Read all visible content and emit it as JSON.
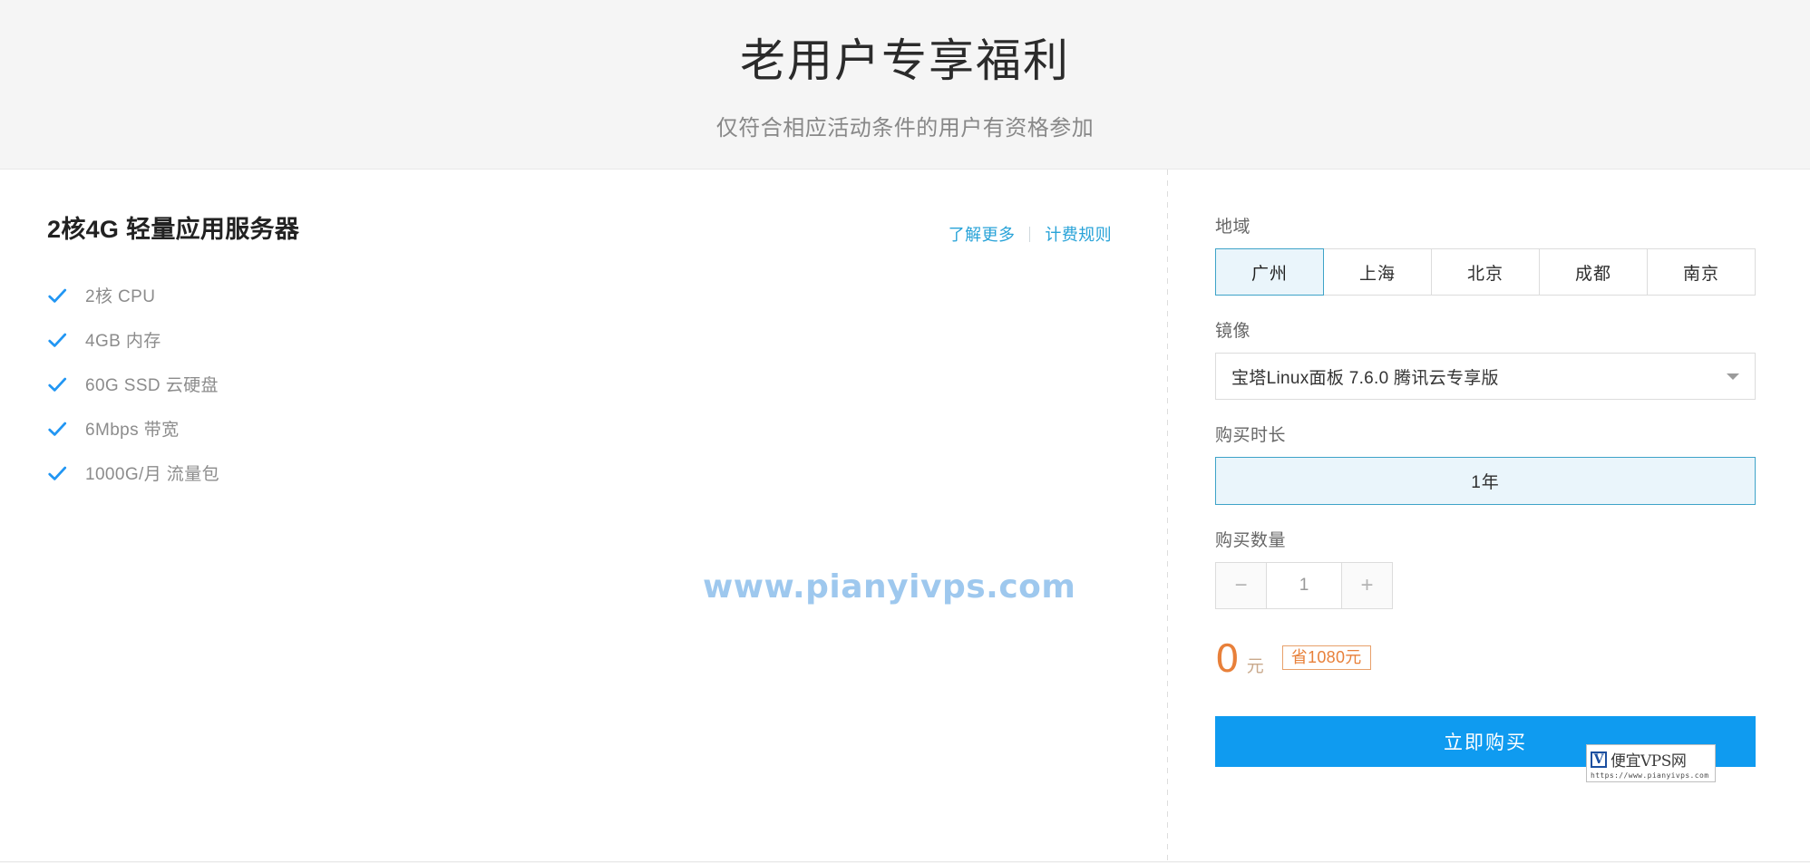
{
  "header": {
    "title": "老用户专享福利",
    "subtitle": "仅符合相应活动条件的用户有资格参加"
  },
  "product": {
    "title": "2核4G 轻量应用服务器",
    "links": [
      {
        "label": "了解更多",
        "name": "learn-more-link"
      },
      {
        "label": "计费规则",
        "name": "billing-rules-link"
      }
    ],
    "features": [
      "2核 CPU",
      "4GB 内存",
      "60G SSD 云硬盘",
      "6Mbps 带宽",
      "1000G/月 流量包"
    ]
  },
  "config": {
    "region": {
      "label": "地域",
      "options": [
        "广州",
        "上海",
        "北京",
        "成都",
        "南京"
      ],
      "selected": "广州"
    },
    "image": {
      "label": "镜像",
      "value": "宝塔Linux面板 7.6.0 腾讯云专享版"
    },
    "duration": {
      "label": "购买时长",
      "options": [
        "1年"
      ],
      "selected": "1年"
    },
    "quantity": {
      "label": "购买数量",
      "value": "1",
      "decrement": "−",
      "increment": "+"
    }
  },
  "price": {
    "amount": "0",
    "unit": "元",
    "save_badge": "省1080元",
    "accent_color": "#e8803a"
  },
  "actions": {
    "buy_label": "立即购买",
    "buy_color": "#0f9bf0"
  },
  "watermarks": {
    "center_text": "www.pianyivps.com",
    "center_color": "#9ec8ee",
    "badge_logo": "V",
    "badge_name": "便宜VPS网",
    "badge_url": "https://www.pianyivps.com"
  }
}
